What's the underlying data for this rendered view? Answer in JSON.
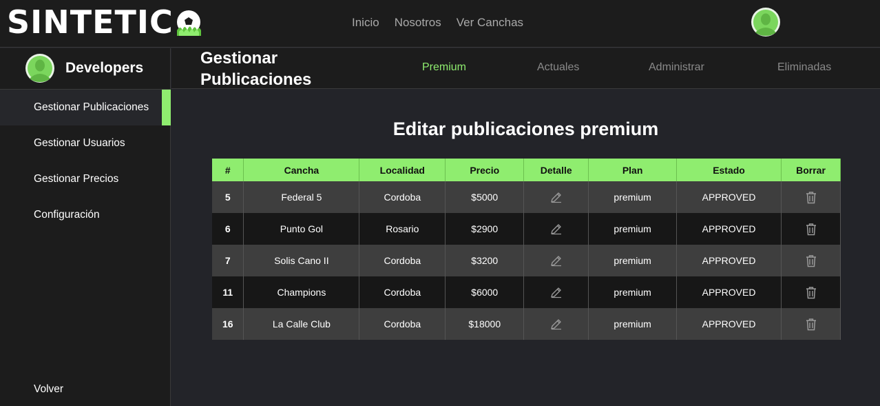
{
  "topbar": {
    "logo_text": "SINTETIC",
    "nav": [
      "Inicio",
      "Nosotros",
      "Ver Canchas"
    ]
  },
  "sidebar": {
    "user_name": "Developers",
    "items": [
      {
        "label": "Gestionar Publicaciones",
        "active": true
      },
      {
        "label": "Gestionar Usuarios",
        "active": false
      },
      {
        "label": "Gestionar Precios",
        "active": false
      },
      {
        "label": "Configuración",
        "active": false
      }
    ],
    "back_label": "Volver"
  },
  "header": {
    "title_line1": "Gestionar",
    "title_line2": "Publicaciones",
    "tabs": [
      {
        "label": "Premium",
        "active": true
      },
      {
        "label": "Actuales",
        "active": false
      },
      {
        "label": "Administrar",
        "active": false
      },
      {
        "label": "Eliminadas",
        "active": false
      }
    ]
  },
  "main": {
    "title": "Editar publicaciones premium",
    "columns": [
      "#",
      "Cancha",
      "Localidad",
      "Precio",
      "Detalle",
      "Plan",
      "Estado",
      "Borrar"
    ],
    "rows": [
      {
        "id": "5",
        "cancha": "Federal 5",
        "localidad": "Cordoba",
        "precio": "$5000",
        "plan": "premium",
        "estado": "APPROVED"
      },
      {
        "id": "6",
        "cancha": "Punto Gol",
        "localidad": "Rosario",
        "precio": "$2900",
        "plan": "premium",
        "estado": "APPROVED"
      },
      {
        "id": "7",
        "cancha": "Solis Cano II",
        "localidad": "Cordoba",
        "precio": "$3200",
        "plan": "premium",
        "estado": "APPROVED"
      },
      {
        "id": "11",
        "cancha": "Champions",
        "localidad": "Cordoba",
        "precio": "$6000",
        "plan": "premium",
        "estado": "APPROVED"
      },
      {
        "id": "16",
        "cancha": "La Calle Club",
        "localidad": "Cordoba",
        "precio": "$18000",
        "plan": "premium",
        "estado": "APPROVED"
      }
    ]
  },
  "colors": {
    "accent": "#8fed6f",
    "background": "#232429",
    "panel": "#1c1c1c"
  },
  "icons": {
    "edit": "pencil-icon",
    "delete": "trash-icon",
    "avatar": "user-avatar-icon",
    "logo": "soccer-ball-grass-icon"
  }
}
